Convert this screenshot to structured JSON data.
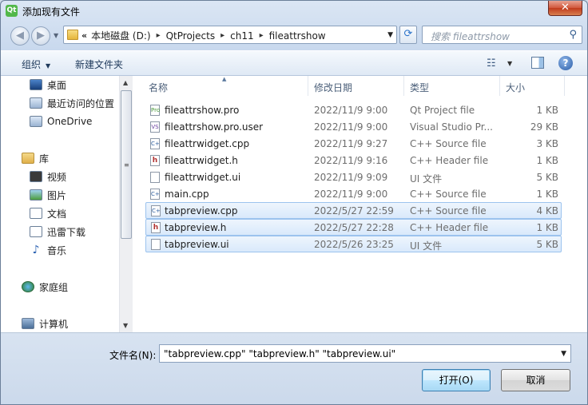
{
  "window": {
    "title": "添加现有文件",
    "app_icon_text": "Qt",
    "close_glyph": "✕"
  },
  "nav": {
    "back_glyph": "◀",
    "forward_glyph": "▶",
    "recent_glyph": "▼",
    "path_chevron": "«",
    "path": [
      "本地磁盘 (D:)",
      "QtProjects",
      "ch11",
      "fileattrshow"
    ],
    "path_sep": "▸",
    "path_dropdown_glyph": "▼",
    "refresh_glyph": "⟳",
    "search_placeholder": "搜索 fileattrshow",
    "search_glyph": "⚲"
  },
  "toolbar": {
    "organize_label": "组织",
    "organize_arrow": "▼",
    "new_folder_label": "新建文件夹",
    "view_glyph": "☷",
    "view_dropdown_glyph": "▼",
    "help_glyph": "?"
  },
  "sidebar": {
    "items": [
      {
        "label": "桌面",
        "icon": "desktop-icon"
      },
      {
        "label": "最近访问的位置",
        "icon": "recent-places-icon"
      },
      {
        "label": "OneDrive",
        "icon": "onedrive-icon"
      },
      {
        "label": "库",
        "icon": "library-icon"
      },
      {
        "label": "视频",
        "icon": "video-icon"
      },
      {
        "label": "图片",
        "icon": "pictures-icon"
      },
      {
        "label": "文档",
        "icon": "documents-icon"
      },
      {
        "label": "迅雷下载",
        "icon": "download-icon"
      },
      {
        "label": "音乐",
        "icon": "music-icon",
        "glyph": "♪"
      },
      {
        "label": "家庭组",
        "icon": "homegroup-icon"
      },
      {
        "label": "计算机",
        "icon": "computer-icon"
      }
    ],
    "scroll_up": "▲",
    "scroll_down": "▼",
    "scroll_grip": "≡"
  },
  "columns": {
    "name": "名称",
    "modified": "修改日期",
    "type": "类型",
    "size": "大小",
    "sort_glyph": "▲"
  },
  "files": [
    {
      "name": "fileattrshow.pro",
      "date": "2022/11/9 9:00",
      "type": "Qt Project file",
      "size": "1 KB",
      "icon_text": "Pro",
      "selected": false
    },
    {
      "name": "fileattrshow.pro.user",
      "date": "2022/11/9 9:00",
      "type": "Visual Studio Pr...",
      "size": "29 KB",
      "icon_text": "VS",
      "selected": false
    },
    {
      "name": "fileattrwidget.cpp",
      "date": "2022/11/9 9:27",
      "type": "C++ Source file",
      "size": "3 KB",
      "icon_text": "C+",
      "selected": false
    },
    {
      "name": "fileattrwidget.h",
      "date": "2022/11/9 9:16",
      "type": "C++ Header file",
      "size": "1 KB",
      "icon_text": "h",
      "selected": false
    },
    {
      "name": "fileattrwidget.ui",
      "date": "2022/11/9 9:09",
      "type": "UI 文件",
      "size": "5 KB",
      "icon_text": "",
      "selected": false
    },
    {
      "name": "main.cpp",
      "date": "2022/11/9 9:00",
      "type": "C++ Source file",
      "size": "1 KB",
      "icon_text": "C+",
      "selected": false
    },
    {
      "name": "tabpreview.cpp",
      "date": "2022/5/27 22:59",
      "type": "C++ Source file",
      "size": "4 KB",
      "icon_text": "C+",
      "selected": true
    },
    {
      "name": "tabpreview.h",
      "date": "2022/5/27 22:28",
      "type": "C++ Header file",
      "size": "1 KB",
      "icon_text": "h",
      "selected": true
    },
    {
      "name": "tabpreview.ui",
      "date": "2022/5/26 23:25",
      "type": "UI 文件",
      "size": "5 KB",
      "icon_text": "",
      "selected": true
    }
  ],
  "footer": {
    "filename_label": "文件名(N):",
    "filename_value": "\"tabpreview.cpp\" \"tabpreview.h\" \"tabpreview.ui\"",
    "filename_dropdown_glyph": "▼",
    "open_label": "打开(O)",
    "cancel_label": "取消"
  }
}
